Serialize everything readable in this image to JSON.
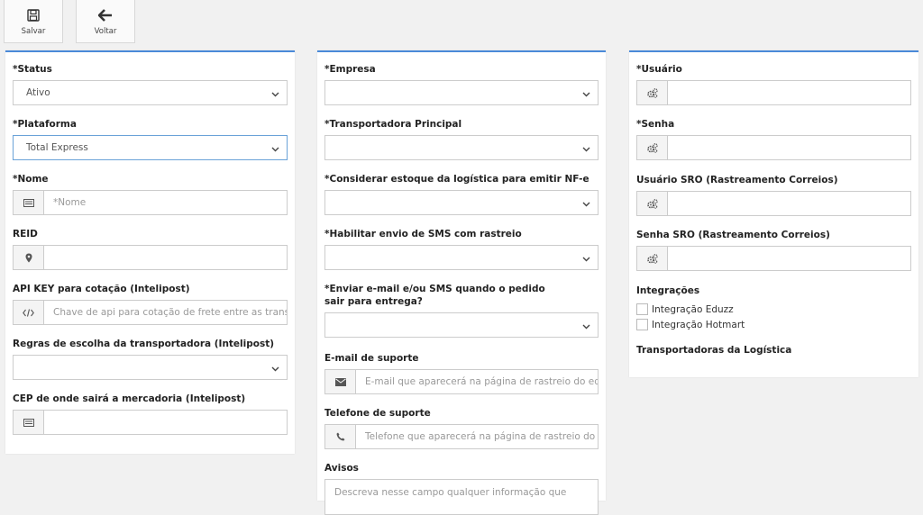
{
  "toolbar": {
    "save_label": "Salvar",
    "save_icon": "floppy-disk-icon",
    "back_label": "Voltar",
    "back_icon": "arrow-left-icon"
  },
  "col1": {
    "status_label": "*Status",
    "status_value": "Ativo",
    "plataforma_label": "*Plataforma",
    "plataforma_value": "Total Express",
    "nome_label": "*Nome",
    "nome_placeholder": "*Nome",
    "reid_label": "REID",
    "apikey_label": "API KEY para cotação (Intelipost)",
    "apikey_placeholder": "Chave de api para cotação de frete entre as transpo",
    "regras_label": "Regras de escolha da transportadora (Intelipost)",
    "cep_label": "CEP de onde sairá a mercadoria (Intelipost)"
  },
  "col2": {
    "empresa_label": "*Empresa",
    "transportadora_label": "*Transportadora Principal",
    "estoque_label": "*Considerar estoque da logística para emitir NF-e",
    "sms_label": "*Habilitar envio de SMS com rastreio",
    "enviar_label": "*Enviar e-mail e/ou SMS quando o pedido sair para entrega?",
    "email_label": "E-mail de suporte",
    "email_placeholder": "E-mail que aparecerá na página de rastreio do eduz",
    "telefone_label": "Telefone de suporte",
    "telefone_placeholder": "Telefone que aparecerá na página de rastreio do edı",
    "avisos_label": "Avisos",
    "avisos_placeholder": "Descreva nesse campo qualquer informação que"
  },
  "col3": {
    "usuario_label": "*Usuário",
    "senha_label": "*Senha",
    "usuario_sro_label": "Usuário SRO (Rastreamento Correios)",
    "senha_sro_label": "Senha SRO (Rastreamento Correios)",
    "integracoes_label": "Integrações",
    "integracao_eduzz": "Integração Eduzz",
    "integracao_hotmart": "Integração Hotmart",
    "transportadoras_label": "Transportadoras da Logística"
  },
  "colors": {
    "accent": "#4a8ad8",
    "border": "#cccccc",
    "background": "#f1f1f1"
  }
}
